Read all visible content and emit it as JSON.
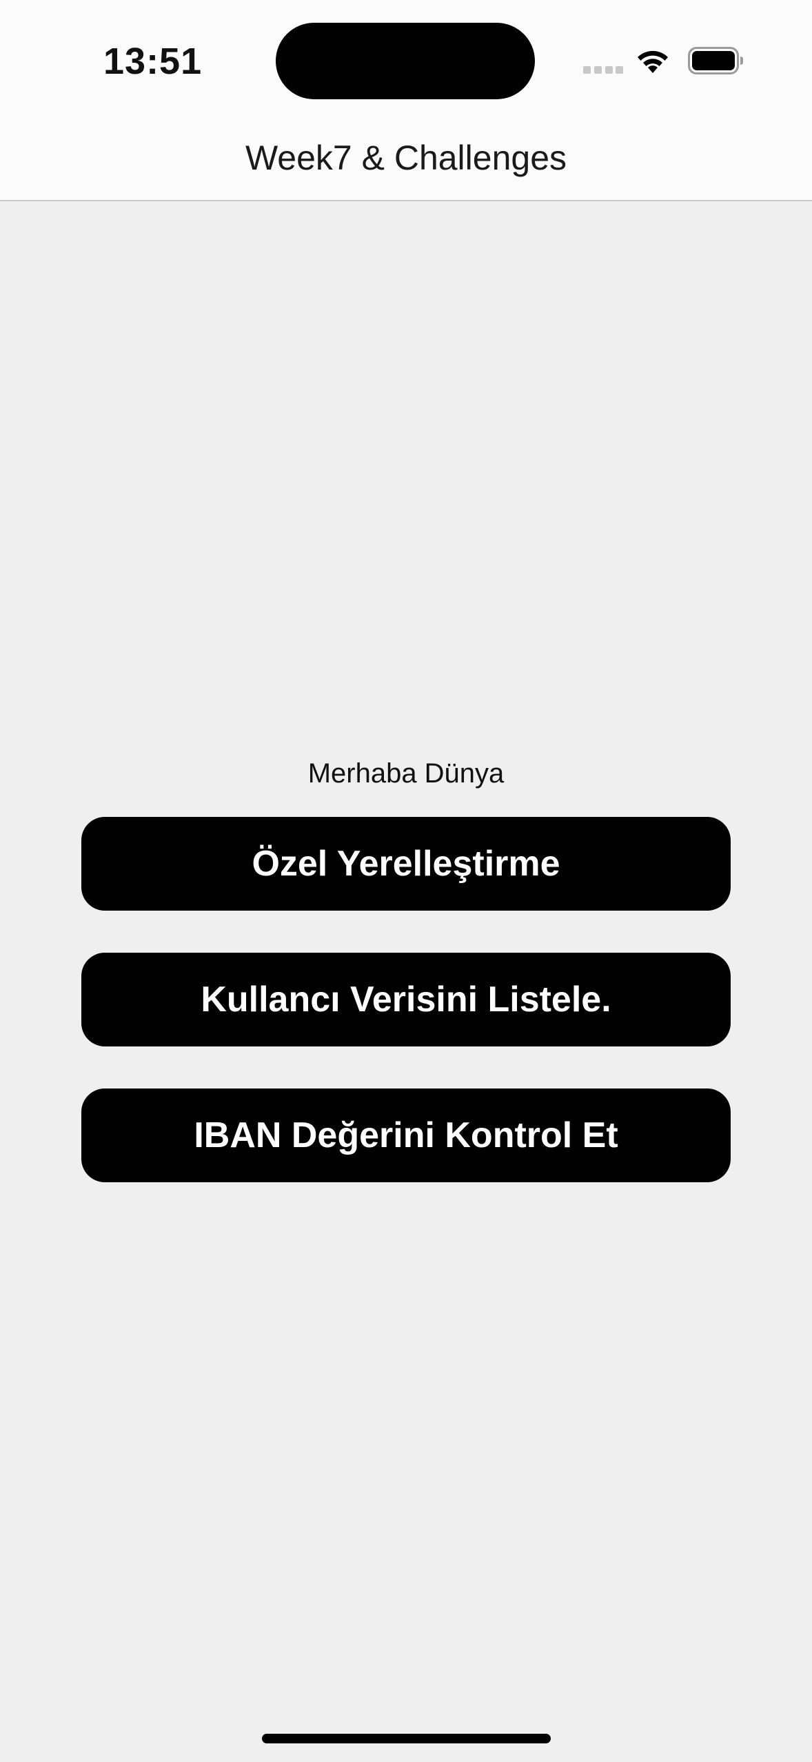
{
  "status_bar": {
    "time": "13:51",
    "icons": [
      "signal-icon",
      "wifi-icon",
      "battery-icon"
    ]
  },
  "nav": {
    "title": "Week7 & Challenges"
  },
  "main": {
    "greeting": "Merhaba Dünya",
    "buttons": [
      {
        "label": "Özel Yerelleştirme"
      },
      {
        "label": "Kullancı Verisini Listele."
      },
      {
        "label": "IBAN Değerini Kontrol Et"
      }
    ]
  },
  "colors": {
    "background": "#efefef",
    "bar_background": "#fbfbfb",
    "button_background": "#000000",
    "button_text": "#ffffff"
  }
}
